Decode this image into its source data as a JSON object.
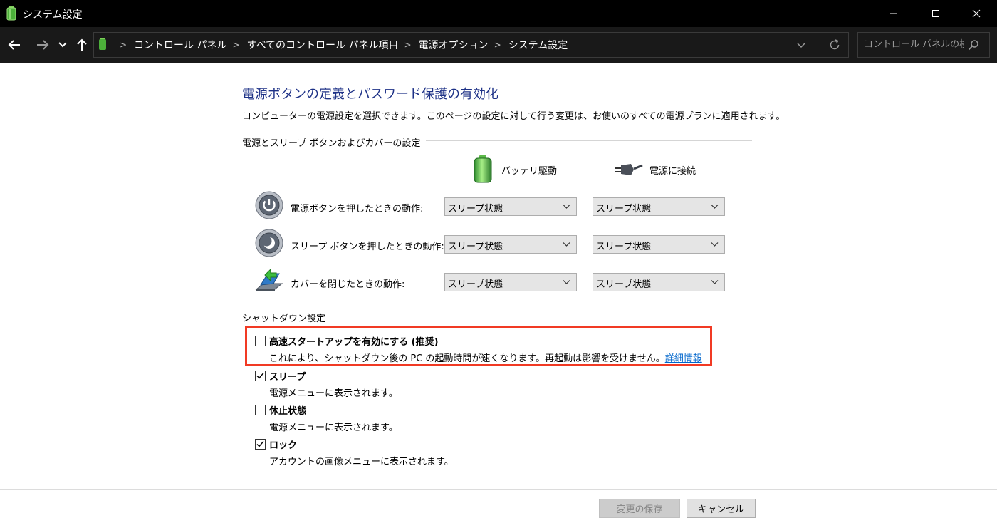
{
  "window": {
    "title": "システム設定"
  },
  "address": {
    "breadcrumbs": [
      "コントロール パネル",
      "すべてのコントロール パネル項目",
      "電源オプション",
      "システム設定"
    ],
    "search_placeholder": "コントロール パネルの検..."
  },
  "page": {
    "heading": "電源ボタンの定義とパスワード保護の有効化",
    "description": "コンピューターの電源設定を選択できます。このページの設定に対して行う変更は、お使いのすべての電源プランに適用されます。"
  },
  "buttons_section": {
    "title": "電源とスリープ ボタンおよびカバーの設定",
    "battery_label": "バッテリ駆動",
    "plugged_label": "電源に接続",
    "rows": [
      {
        "label": "電源ボタンを押したときの動作:",
        "battery": "スリープ状態",
        "plugged": "スリープ状態",
        "icon": "power-button-icon"
      },
      {
        "label": "スリープ ボタンを押したときの動作:",
        "battery": "スリープ状態",
        "plugged": "スリープ状態",
        "icon": "sleep-button-icon"
      },
      {
        "label": "カバーを閉じたときの動作:",
        "battery": "スリープ状態",
        "plugged": "スリープ状態",
        "icon": "laptop-lid-icon"
      }
    ]
  },
  "shutdown_section": {
    "title": "シャットダウン設定",
    "options": [
      {
        "label": "高速スタートアップを有効にする (推奨)",
        "description": "これにより、シャットダウン後の PC の起動時間が速くなります。再起動は影響を受けません。",
        "link": "詳細情報",
        "checked": false
      },
      {
        "label": "スリープ",
        "description": "電源メニューに表示されます。",
        "checked": true
      },
      {
        "label": "休止状態",
        "description": "電源メニューに表示されます。",
        "checked": false
      },
      {
        "label": "ロック",
        "description": "アカウントの画像メニューに表示されます。",
        "checked": true
      }
    ]
  },
  "footer": {
    "save_label": "変更の保存",
    "cancel_label": "キャンセル"
  },
  "colors": {
    "heading": "#1e3287",
    "link": "#0066cc",
    "highlight": "#f13a24",
    "titlebar": "#000000",
    "addressbar": "#191919"
  }
}
